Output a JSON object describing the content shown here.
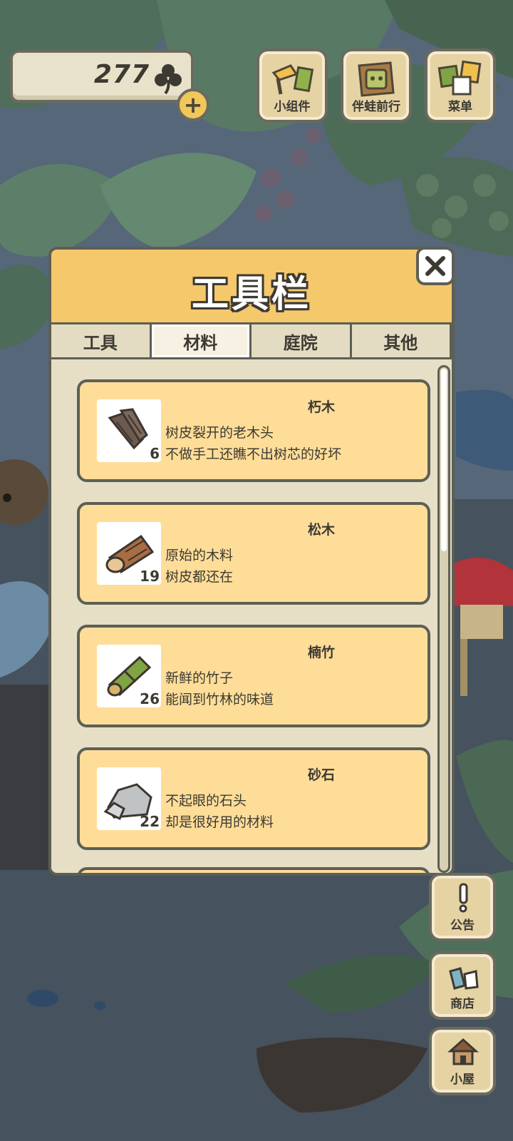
{
  "currency": {
    "count": "277",
    "icon": "clover-icon",
    "add_icon": "plus-icon"
  },
  "top_buttons": [
    {
      "label": "小组件",
      "icon": "widget-icon"
    },
    {
      "label": "伴蛙前行",
      "icon": "frog-journey-icon"
    },
    {
      "label": "菜单",
      "icon": "menu-icon"
    }
  ],
  "panel": {
    "title": "工具栏",
    "close_icon": "close-icon",
    "tabs": [
      {
        "label": "工具",
        "active": false
      },
      {
        "label": "材料",
        "active": true
      },
      {
        "label": "庭院",
        "active": false
      },
      {
        "label": "其他",
        "active": false
      }
    ],
    "items": [
      {
        "name": "朽木",
        "qty": "6",
        "line1": "树皮裂开的老木头",
        "line2": "不做手工还瞧不出树芯的好坏",
        "icon": "rotten-wood-icon"
      },
      {
        "name": "松木",
        "qty": "19",
        "line1": "原始的木料",
        "line2": "树皮都还在",
        "icon": "pine-log-icon"
      },
      {
        "name": "楠竹",
        "qty": "26",
        "line1": "新鲜的竹子",
        "line2": "能闻到竹林的味道",
        "icon": "bamboo-icon"
      },
      {
        "name": "砂石",
        "qty": "22",
        "line1": "不起眼的石头",
        "line2": "却是很好用的材料",
        "icon": "stone-icon"
      }
    ]
  },
  "side_buttons": [
    {
      "label": "公告",
      "icon": "notice-icon"
    },
    {
      "label": "商店",
      "icon": "shop-icon"
    },
    {
      "label": "小屋",
      "icon": "house-icon"
    }
  ],
  "colors": {
    "panel_header": "#f5c86c",
    "item_bg": "#fedd98",
    "outline": "#5d5f54",
    "button_bg": "#e5d3a4"
  }
}
